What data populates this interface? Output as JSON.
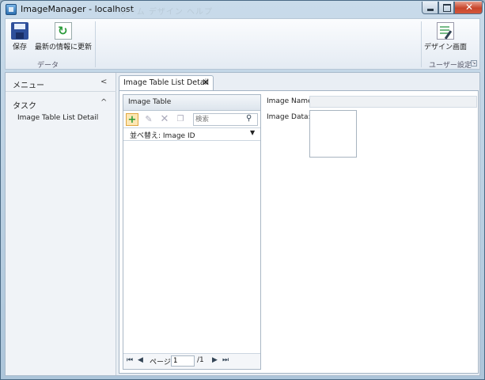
{
  "window": {
    "title": "ImageManager - localhost",
    "title_ghost": "ホーム デザイン ヘルプ"
  },
  "ribbon": {
    "save_label": "保存",
    "refresh_label": "最新の情報に更新",
    "group_data": "データ",
    "design_label": "デザイン画面",
    "group_user": "ユーザー設定"
  },
  "sidebar": {
    "menu_label": "メニュー",
    "menu_chevron": "<",
    "task_label": "タスク",
    "task_chevron": "^",
    "items": [
      {
        "label": "Image Table List Detail"
      }
    ]
  },
  "tab": {
    "label": "Image Table List Detail",
    "close": "✕"
  },
  "list": {
    "title": "Image Table",
    "search_placeholder": "検索",
    "sort_label": "並べ替え: Image ID",
    "pager": {
      "page_label": "ページ",
      "current": "1",
      "total": "/1"
    }
  },
  "detail": {
    "name_label": "Image Name:",
    "data_label": "Image Data:"
  }
}
